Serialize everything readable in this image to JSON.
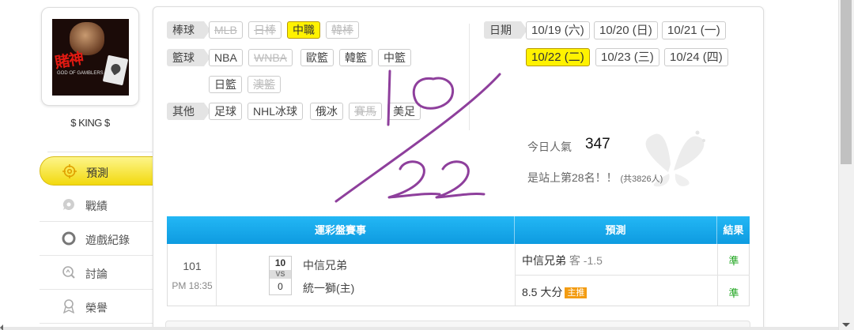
{
  "profile": {
    "username": "$ KING $",
    "avatar_text": "賭神",
    "avatar_sub": "GOD OF GAMBLERS"
  },
  "sidebar": {
    "items": [
      {
        "label": "預測",
        "icon": "target-icon",
        "active": true
      },
      {
        "label": "戰績",
        "icon": "chat-bubble-icon",
        "active": false
      },
      {
        "label": "遊戲紀錄",
        "icon": "ring-icon",
        "active": false
      },
      {
        "label": "討論",
        "icon": "magnifier-chat-icon",
        "active": false
      },
      {
        "label": "榮譽",
        "icon": "medal-icon",
        "active": false
      }
    ]
  },
  "filters": {
    "baseball": {
      "label": "棒球",
      "options": [
        {
          "label": "MLB",
          "state": "disabled"
        },
        {
          "label": "日棒",
          "state": "disabled"
        },
        {
          "label": "中職",
          "state": "selected"
        },
        {
          "label": "韓棒",
          "state": "disabled"
        }
      ]
    },
    "basketball": {
      "label": "籃球",
      "options": [
        {
          "label": "NBA",
          "state": "normal"
        },
        {
          "label": "WNBA",
          "state": "disabled"
        },
        {
          "label": "歐籃",
          "state": "normal"
        },
        {
          "label": "韓籃",
          "state": "normal"
        },
        {
          "label": "中籃",
          "state": "normal"
        },
        {
          "label": "日籃",
          "state": "normal"
        },
        {
          "label": "澳籃",
          "state": "disabled"
        }
      ]
    },
    "others": {
      "label": "其他",
      "options": [
        {
          "label": "足球",
          "state": "normal"
        },
        {
          "label": "NHL冰球",
          "state": "normal"
        },
        {
          "label": "俄冰",
          "state": "normal"
        },
        {
          "label": "賽馬",
          "state": "disabled"
        },
        {
          "label": "美足",
          "state": "normal"
        }
      ]
    }
  },
  "dates": {
    "label": "日期",
    "options": [
      {
        "label": "10/19 (六)",
        "state": "normal"
      },
      {
        "label": "10/20 (日)",
        "state": "normal"
      },
      {
        "label": "10/21 (一)",
        "state": "normal"
      },
      {
        "label": "10/22 (二)",
        "state": "selected"
      },
      {
        "label": "10/23 (三)",
        "state": "normal"
      },
      {
        "label": "10/24 (四)",
        "state": "normal"
      }
    ]
  },
  "popularity": {
    "label": "今日人氣",
    "value": "347",
    "rank_text": "是站上第28名！！",
    "rank_total": "(共3826人)"
  },
  "table": {
    "headers": {
      "match": "運彩盤賽事",
      "prediction": "預測",
      "result": "結果"
    },
    "rows": [
      {
        "game_no": "101",
        "time": "PM 18:35",
        "score_home": "10",
        "vs": "VS",
        "score_away": "0",
        "team_a": "中信兄弟",
        "team_b": "統一獅(主)",
        "prediction_1_team": "中信兄弟",
        "prediction_1_detail": "客 -1.5",
        "result_1": "準",
        "prediction_2": "8.5 大分",
        "prediction_2_badge": "主推",
        "result_2": "準"
      }
    ]
  },
  "colors": {
    "accent_yellow": "#fff200",
    "header_blue": "#12a5e8",
    "result_green": "#1aa31a",
    "scribble_purple": "#8e3f9c",
    "badge_orange": "#f39c12"
  }
}
